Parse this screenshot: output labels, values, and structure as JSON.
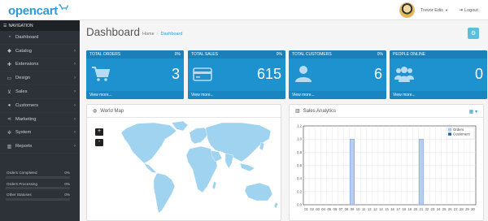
{
  "header": {
    "logo_text": "opencart",
    "user_name": "Trevor Edis",
    "logout_label": "Logout"
  },
  "sidebar": {
    "heading": "NAVIGATION",
    "items": [
      {
        "label": "Dashboard",
        "icon": "dashboard-icon",
        "has_children": false
      },
      {
        "label": "Catalog",
        "icon": "tag-icon",
        "has_children": true
      },
      {
        "label": "Extensions",
        "icon": "puzzle-icon",
        "has_children": true
      },
      {
        "label": "Design",
        "icon": "monitor-icon",
        "has_children": true
      },
      {
        "label": "Sales",
        "icon": "cart-icon",
        "has_children": true
      },
      {
        "label": "Customers",
        "icon": "user-icon",
        "has_children": true
      },
      {
        "label": "Marketing",
        "icon": "share-icon",
        "has_children": true
      },
      {
        "label": "System",
        "icon": "cog-icon",
        "has_children": true
      },
      {
        "label": "Reports",
        "icon": "bar-chart-icon",
        "has_children": true
      }
    ],
    "stats": [
      {
        "label": "Orders Completed",
        "value": "0%",
        "progress": 0
      },
      {
        "label": "Orders Processing",
        "value": "0%",
        "progress": 0
      },
      {
        "label": "Other Statuses",
        "value": "0%",
        "progress": 0
      }
    ]
  },
  "page": {
    "title": "Dashboard",
    "breadcrumb": [
      "Home",
      "Dashboard"
    ]
  },
  "tiles": [
    {
      "title": "TOTAL ORDERS",
      "percent": "0%",
      "value": "3",
      "icon": "cart-icon",
      "link": "View more..."
    },
    {
      "title": "TOTAL SALES",
      "percent": "0%",
      "value": "615",
      "icon": "credit-card-icon",
      "link": "View more..."
    },
    {
      "title": "TOTAL CUSTOMERS",
      "percent": "0%",
      "value": "6",
      "icon": "user-icon",
      "link": "View more..."
    },
    {
      "title": "PEOPLE ONLINE",
      "percent": "",
      "value": "0",
      "icon": "users-icon",
      "link": "View more..."
    }
  ],
  "world_map": {
    "title": "World Map",
    "zoom_in": "+",
    "zoom_out": "-"
  },
  "analytics": {
    "title": "Sales Analytics"
  },
  "colors": {
    "accent": "#1e91cf",
    "sidebar": "#2c3238",
    "map_land": "#9fd3ef",
    "orders_series": "#b6cef1",
    "customers_series": "#2554a4"
  },
  "chart_data": {
    "type": "bar",
    "title": "",
    "categories": [
      "01",
      "02",
      "03",
      "04",
      "05",
      "06",
      "07",
      "08",
      "09",
      "10",
      "11",
      "12",
      "13",
      "14",
      "15",
      "16",
      "17",
      "18",
      "19",
      "20",
      "21",
      "22",
      "23",
      "24",
      "25",
      "26",
      "27",
      "28",
      "29",
      "30"
    ],
    "series": [
      {
        "name": "Orders",
        "values": [
          0,
          0,
          0,
          0,
          0,
          0,
          0,
          0,
          1,
          0,
          0,
          0,
          0,
          0,
          0,
          0,
          0,
          0,
          0,
          0,
          1,
          0,
          0,
          0,
          0,
          0,
          0,
          0,
          0,
          0
        ]
      },
      {
        "name": "Customers",
        "values": [
          0,
          0,
          0,
          0,
          0,
          0,
          0,
          0,
          0,
          0,
          0,
          0,
          0,
          0,
          0,
          0,
          0,
          0,
          0,
          0,
          0,
          0,
          0,
          0,
          0,
          0,
          0,
          0,
          0,
          0
        ]
      }
    ],
    "yticks": [
      "0.0",
      "0.2",
      "0.4",
      "0.6",
      "0.8",
      "1.0",
      "1.2"
    ],
    "ylim": [
      0,
      1.2
    ],
    "grid": true,
    "legend": "top-right"
  }
}
